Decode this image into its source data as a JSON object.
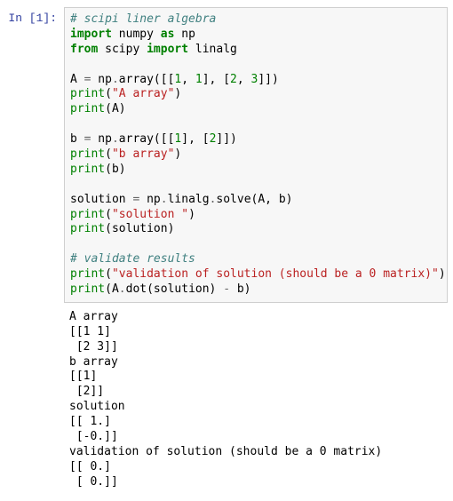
{
  "prompt": {
    "label": "In [1]:"
  },
  "code": {
    "c01": "# scipi liner algebra",
    "c02a": "import",
    "c02b": " numpy ",
    "c02c": "as",
    "c02d": " np",
    "c03a": "from",
    "c03b": " scipy ",
    "c03c": "import",
    "c03d": " linalg",
    "c04": "",
    "c05a": "A ",
    "c05b": "=",
    "c05c": " np",
    "c05d": ".",
    "c05e": "array([[",
    "c05f": "1",
    "c05g": ", ",
    "c05h": "1",
    "c05i": "], [",
    "c05j": "2",
    "c05k": ", ",
    "c05l": "3",
    "c05m": "]])",
    "c06a": "print",
    "c06b": "(",
    "c06c": "\"A array\"",
    "c06d": ")",
    "c07a": "print",
    "c07b": "(A)",
    "c08": "",
    "c09a": "b ",
    "c09b": "=",
    "c09c": " np",
    "c09d": ".",
    "c09e": "array([[",
    "c09f": "1",
    "c09g": "], [",
    "c09h": "2",
    "c09i": "]])",
    "c10a": "print",
    "c10b": "(",
    "c10c": "\"b array\"",
    "c10d": ")",
    "c11a": "print",
    "c11b": "(b)",
    "c12": "",
    "c13a": "solution ",
    "c13b": "=",
    "c13c": " np",
    "c13d": ".",
    "c13e": "linalg",
    "c13f": ".",
    "c13g": "solve(A, b)",
    "c14a": "print",
    "c14b": "(",
    "c14c": "\"solution \"",
    "c14d": ")",
    "c15a": "print",
    "c15b": "(solution)",
    "c16": "",
    "c17": "# validate results",
    "c18a": "print",
    "c18b": "(",
    "c18c": "\"validation of solution (should be a 0 matrix)\"",
    "c18d": ")",
    "c19a": "print",
    "c19b": "(A",
    "c19c": ".",
    "c19d": "dot(solution) ",
    "c19e": "-",
    "c19f": " b)"
  },
  "output": {
    "o01": "A array",
    "o02": "[[1 1]",
    "o03": " [2 3]]",
    "o04": "b array",
    "o05": "[[1]",
    "o06": " [2]]",
    "o07": "solution ",
    "o08": "[[ 1.]",
    "o09": " [-0.]]",
    "o10": "validation of solution (should be a 0 matrix)",
    "o11": "[[ 0.]",
    "o12": " [ 0.]]"
  }
}
